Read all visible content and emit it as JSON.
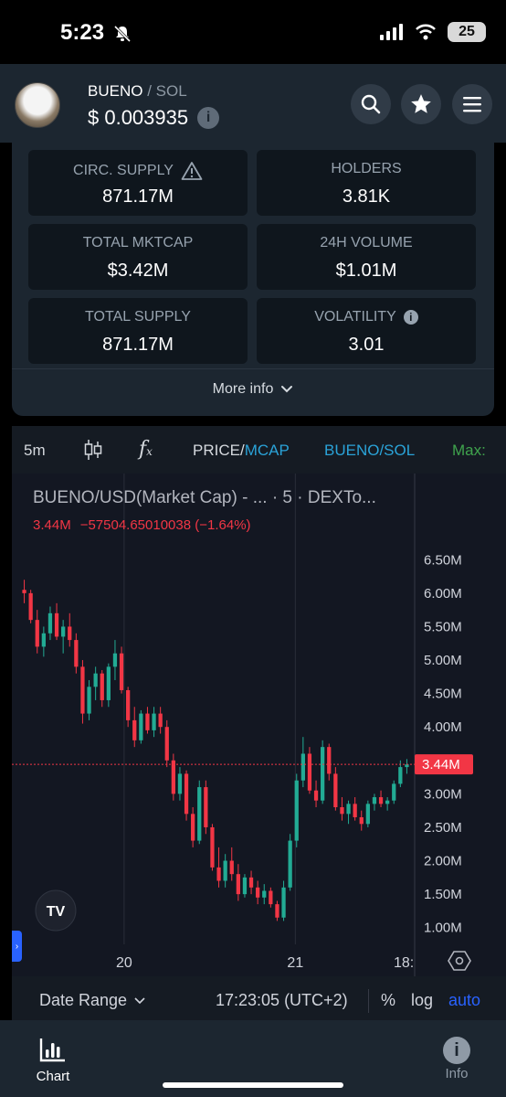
{
  "status": {
    "time": "5:23",
    "battery": "25"
  },
  "header": {
    "token": "BUENO",
    "quote": "SOL",
    "price": "$ 0.003935",
    "info_glyph": "i"
  },
  "stats": [
    {
      "label": "CIRC. SUPPLY",
      "value": "871.17M"
    },
    {
      "label": "HOLDERS",
      "value": "3.81K"
    },
    {
      "label": "TOTAL MKTCAP",
      "value": "$3.42M"
    },
    {
      "label": "24H VOLUME",
      "value": "$1.01M"
    },
    {
      "label": "TOTAL SUPPLY",
      "value": "871.17M"
    },
    {
      "label": "VOLATILITY",
      "value": "3.01"
    }
  ],
  "more_info": "More info",
  "toolbar": {
    "interval": "5m",
    "fx": "f",
    "fx_sub": "x",
    "price": "PRICE",
    "slash": "/",
    "mcap": "MCAP",
    "pair": "BUENO/SOL",
    "max": "Max:"
  },
  "chart": {
    "legend_title": "BUENO/USD(Market Cap) - ... · 5 · DEXTo...",
    "legend_value": "3.44M",
    "legend_change": "−57504.65010038 (−1.64%)",
    "last_price_label": "3.44M",
    "date_axis_end": "18:",
    "logo": "TV"
  },
  "chart_data": {
    "type": "candlestick",
    "title": "BUENO/USD(Market Cap) - ... · 5 · DEXTo...",
    "y_ticks": [
      "6.50M",
      "6.00M",
      "5.50M",
      "5.00M",
      "4.50M",
      "4.00M",
      "3.50M",
      "3.00M",
      "2.50M",
      "2.00M",
      "1.50M",
      "1.00M"
    ],
    "x_ticks": [
      "20",
      "21",
      "18:"
    ],
    "ylim": [
      0.75,
      6.75
    ],
    "last_value": 3.44,
    "series": [
      {
        "name": "",
        "ohlc": [
          [
            6.05,
            6.2,
            5.85,
            6.0
          ],
          [
            6.0,
            6.05,
            5.55,
            5.6
          ],
          [
            5.6,
            5.75,
            5.1,
            5.2
          ],
          [
            5.2,
            5.5,
            5.05,
            5.4
          ],
          [
            5.4,
            5.8,
            5.3,
            5.7
          ],
          [
            5.7,
            5.85,
            5.3,
            5.35
          ],
          [
            5.35,
            5.6,
            5.1,
            5.5
          ],
          [
            5.5,
            5.7,
            5.2,
            5.3
          ],
          [
            5.3,
            5.4,
            4.8,
            4.9
          ],
          [
            4.9,
            5.0,
            4.05,
            4.2
          ],
          [
            4.2,
            4.7,
            4.1,
            4.6
          ],
          [
            4.6,
            4.9,
            4.4,
            4.8
          ],
          [
            4.8,
            4.85,
            4.3,
            4.4
          ],
          [
            4.4,
            4.95,
            4.3,
            4.9
          ],
          [
            4.9,
            5.3,
            4.7,
            5.1
          ],
          [
            5.1,
            5.2,
            4.5,
            4.55
          ],
          [
            4.55,
            4.6,
            4.0,
            4.1
          ],
          [
            4.1,
            4.3,
            3.7,
            3.8
          ],
          [
            3.8,
            4.25,
            3.75,
            4.2
          ],
          [
            4.2,
            4.3,
            3.9,
            3.95
          ],
          [
            3.95,
            4.3,
            3.85,
            4.2
          ],
          [
            4.2,
            4.3,
            3.9,
            4.0
          ],
          [
            4.0,
            4.1,
            3.4,
            3.5
          ],
          [
            3.5,
            3.6,
            2.9,
            3.0
          ],
          [
            3.0,
            3.4,
            2.9,
            3.3
          ],
          [
            3.3,
            3.35,
            2.6,
            2.7
          ],
          [
            2.7,
            2.8,
            2.2,
            2.3
          ],
          [
            2.3,
            3.2,
            2.25,
            3.1
          ],
          [
            3.1,
            3.2,
            2.4,
            2.5
          ],
          [
            2.5,
            2.55,
            1.85,
            1.9
          ],
          [
            1.9,
            2.2,
            1.6,
            1.7
          ],
          [
            1.7,
            2.1,
            1.6,
            2.0
          ],
          [
            2.0,
            2.2,
            1.7,
            1.8
          ],
          [
            1.8,
            1.95,
            1.4,
            1.5
          ],
          [
            1.5,
            1.8,
            1.45,
            1.75
          ],
          [
            1.75,
            1.85,
            1.5,
            1.6
          ],
          [
            1.6,
            1.7,
            1.35,
            1.45
          ],
          [
            1.45,
            1.65,
            1.35,
            1.55
          ],
          [
            1.55,
            1.6,
            1.3,
            1.35
          ],
          [
            1.35,
            1.4,
            1.1,
            1.15
          ],
          [
            1.15,
            1.7,
            1.1,
            1.6
          ],
          [
            1.6,
            2.4,
            1.55,
            2.3
          ],
          [
            2.3,
            3.3,
            2.2,
            3.2
          ],
          [
            3.2,
            3.85,
            3.1,
            3.6
          ],
          [
            3.6,
            3.7,
            3.0,
            3.05
          ],
          [
            3.05,
            3.2,
            2.8,
            2.9
          ],
          [
            2.9,
            3.8,
            2.85,
            3.7
          ],
          [
            3.7,
            3.75,
            3.2,
            3.3
          ],
          [
            3.3,
            3.4,
            2.75,
            2.8
          ],
          [
            2.8,
            2.95,
            2.6,
            2.7
          ],
          [
            2.7,
            2.9,
            2.55,
            2.85
          ],
          [
            2.85,
            2.95,
            2.6,
            2.65
          ],
          [
            2.65,
            2.75,
            2.45,
            2.55
          ],
          [
            2.55,
            2.9,
            2.5,
            2.85
          ],
          [
            2.85,
            3.0,
            2.75,
            2.95
          ],
          [
            2.95,
            3.05,
            2.8,
            2.85
          ],
          [
            2.85,
            2.95,
            2.75,
            2.9
          ],
          [
            2.9,
            3.2,
            2.85,
            3.15
          ],
          [
            3.15,
            3.5,
            3.1,
            3.4
          ],
          [
            3.4,
            3.52,
            3.3,
            3.44
          ]
        ]
      }
    ]
  },
  "footer": {
    "date_range": "Date Range",
    "time": "17:23:05 (UTC+2)",
    "percent": "%",
    "log": "log",
    "auto": "auto"
  },
  "tabs": [
    {
      "label": "Chart"
    },
    {
      "label": "Info"
    }
  ],
  "colors": {
    "up": "#22ab94",
    "down": "#f23645",
    "accent": "#2962ff",
    "mcap": "#2aa3d8",
    "pair": "#2aa3d8",
    "max": "#3fa34d"
  }
}
